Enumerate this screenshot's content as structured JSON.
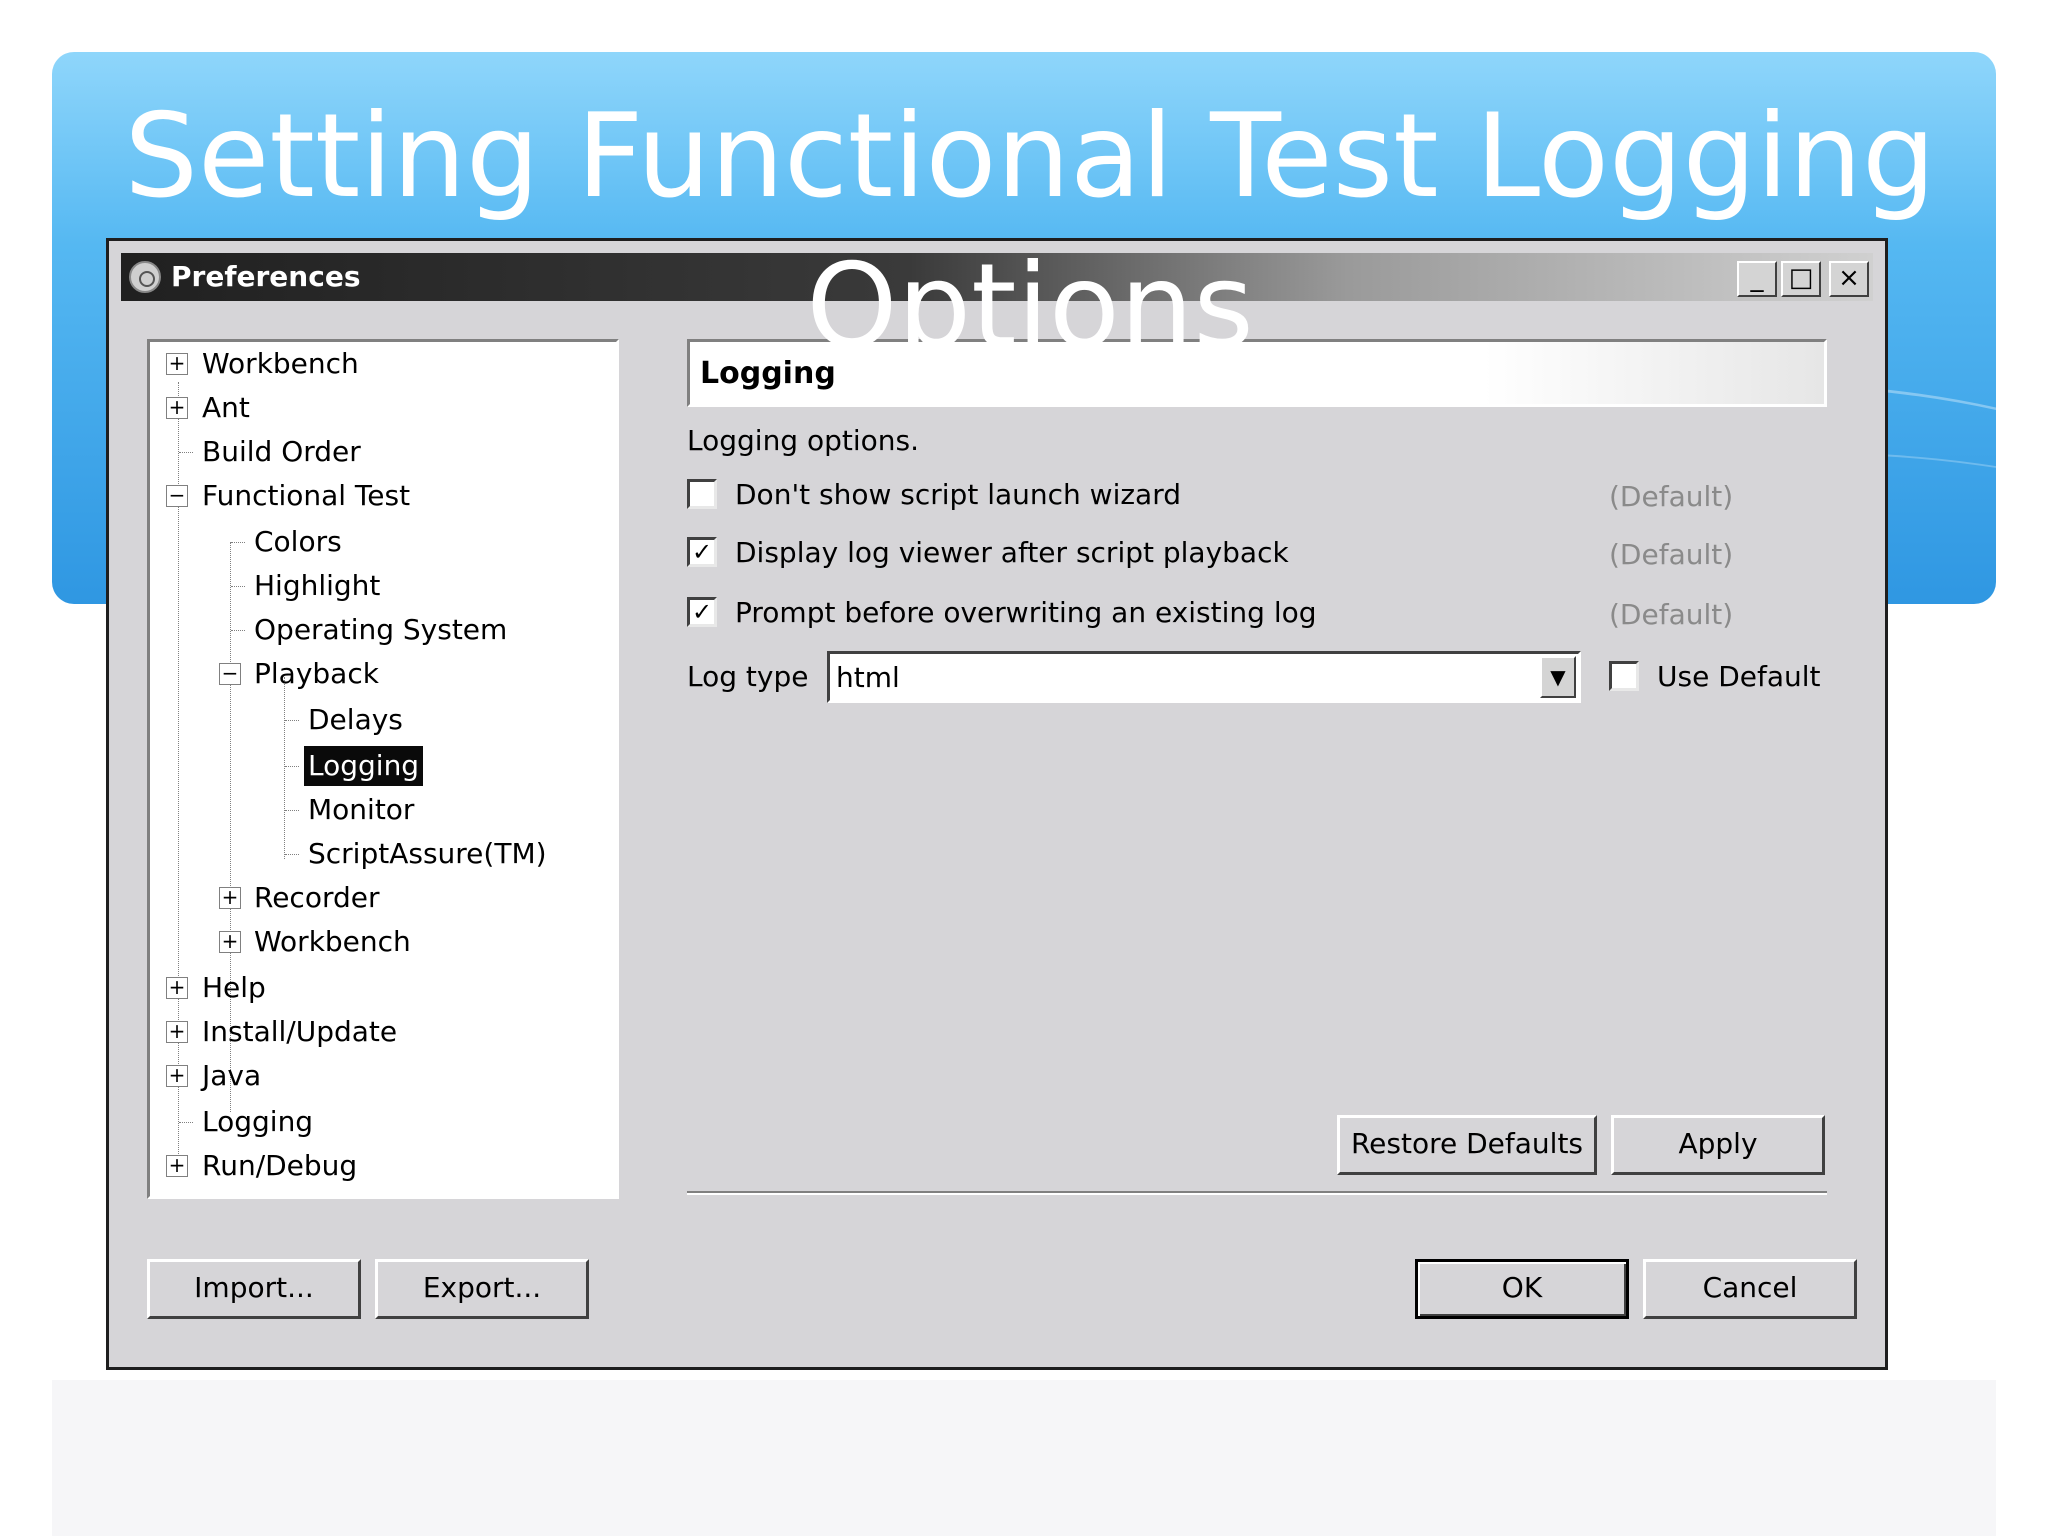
{
  "slide": {
    "title": "Setting Functional Test Logging Options"
  },
  "window": {
    "title": "Preferences",
    "controls": {
      "minimize": "_",
      "maximize": "□",
      "close": "×"
    }
  },
  "tree": {
    "items": [
      {
        "label": "Workbench",
        "expander": "+"
      },
      {
        "label": "Ant",
        "expander": "+"
      },
      {
        "label": "Build Order"
      },
      {
        "label": "Functional Test",
        "expander": "−"
      },
      {
        "label": "Colors"
      },
      {
        "label": "Highlight"
      },
      {
        "label": "Operating System"
      },
      {
        "label": "Playback",
        "expander": "−"
      },
      {
        "label": "Delays"
      },
      {
        "label": "Logging",
        "selected": true
      },
      {
        "label": "Monitor"
      },
      {
        "label": "ScriptAssure(TM)"
      },
      {
        "label": "Recorder",
        "expander": "+"
      },
      {
        "label": "Workbench",
        "expander": "+"
      },
      {
        "label": "Help",
        "expander": "+"
      },
      {
        "label": "Install/Update",
        "expander": "+"
      },
      {
        "label": "Java",
        "expander": "+"
      },
      {
        "label": "Logging"
      },
      {
        "label": "Run/Debug",
        "expander": "+"
      }
    ]
  },
  "page": {
    "header": "Logging",
    "description": "Logging options.",
    "options": [
      {
        "label": "Don't show script launch wizard",
        "checked": false,
        "check_mark": "",
        "default_tag": "(Default)"
      },
      {
        "label": "Display log viewer after script playback",
        "checked": true,
        "check_mark": "✓",
        "default_tag": "(Default)"
      },
      {
        "label": "Prompt before overwriting an existing log",
        "checked": true,
        "check_mark": "✓",
        "default_tag": "(Default)"
      }
    ],
    "log_type": {
      "label": "Log type",
      "value": "html",
      "arrow": "▼",
      "use_default_label": "Use Default",
      "use_default_checked": false
    },
    "restore_defaults_label": "Restore Defaults",
    "apply_label": "Apply"
  },
  "footer": {
    "import_label": "Import...",
    "export_label": "Export...",
    "ok_label": "OK",
    "cancel_label": "Cancel"
  }
}
